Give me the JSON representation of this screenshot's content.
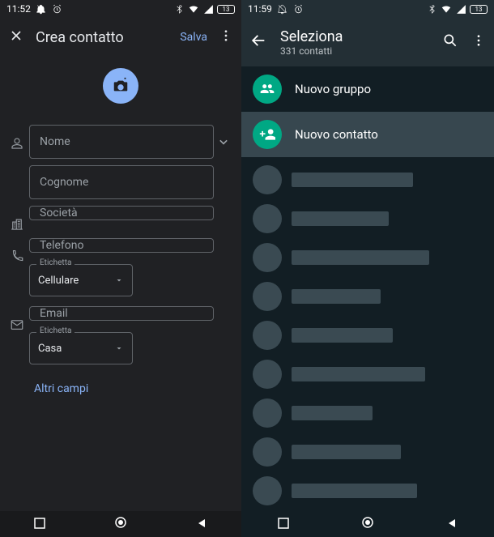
{
  "left": {
    "statusbar": {
      "time": "11:52"
    },
    "header": {
      "title": "Crea contatto",
      "save": "Salva"
    },
    "fields": {
      "name": "Nome",
      "surname": "Cognome",
      "company": "Società",
      "phone": "Telefono",
      "phone_label_caption": "Etichetta",
      "phone_label_value": "Cellulare",
      "email": "Email",
      "email_label_caption": "Etichetta",
      "email_label_value": "Casa"
    },
    "more": "Altri campi"
  },
  "right": {
    "statusbar": {
      "time": "11:59"
    },
    "header": {
      "title": "Seleziona",
      "subtitle": "331 contatti"
    },
    "actions": {
      "new_group": "Nuovo gruppo",
      "new_contact": "Nuovo contatto"
    },
    "fake_contacts": [
      150,
      120,
      170,
      110,
      125,
      165,
      100,
      135,
      155
    ]
  }
}
